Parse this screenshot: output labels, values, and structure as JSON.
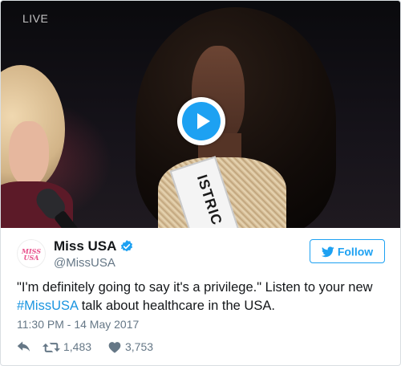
{
  "media": {
    "live_label": "LIVE",
    "sash_text": "ISTRIC"
  },
  "header": {
    "avatar_text_line1": "MISS",
    "avatar_text_line2": "USA",
    "display_name": "Miss USA",
    "screen_name": "@MissUSA",
    "follow_label": "Follow"
  },
  "tweet": {
    "text_before": "\"I'm definitely going to say it's a privilege.\" Listen to your new ",
    "hashtag": "#MissUSA",
    "text_after": " talk about healthcare in the USA.",
    "timestamp": "11:30 PM - 14 May 2017"
  },
  "actions": {
    "retweet_count": "1,483",
    "like_count": "3,753"
  },
  "colors": {
    "accent": "#1da1f2",
    "link": "#1b95e0",
    "muted": "#657786",
    "brand_pink": "#e8508c"
  },
  "icons": [
    "play-icon",
    "verified-icon",
    "bird-icon",
    "reply-icon",
    "retweet-icon",
    "heart-icon"
  ]
}
